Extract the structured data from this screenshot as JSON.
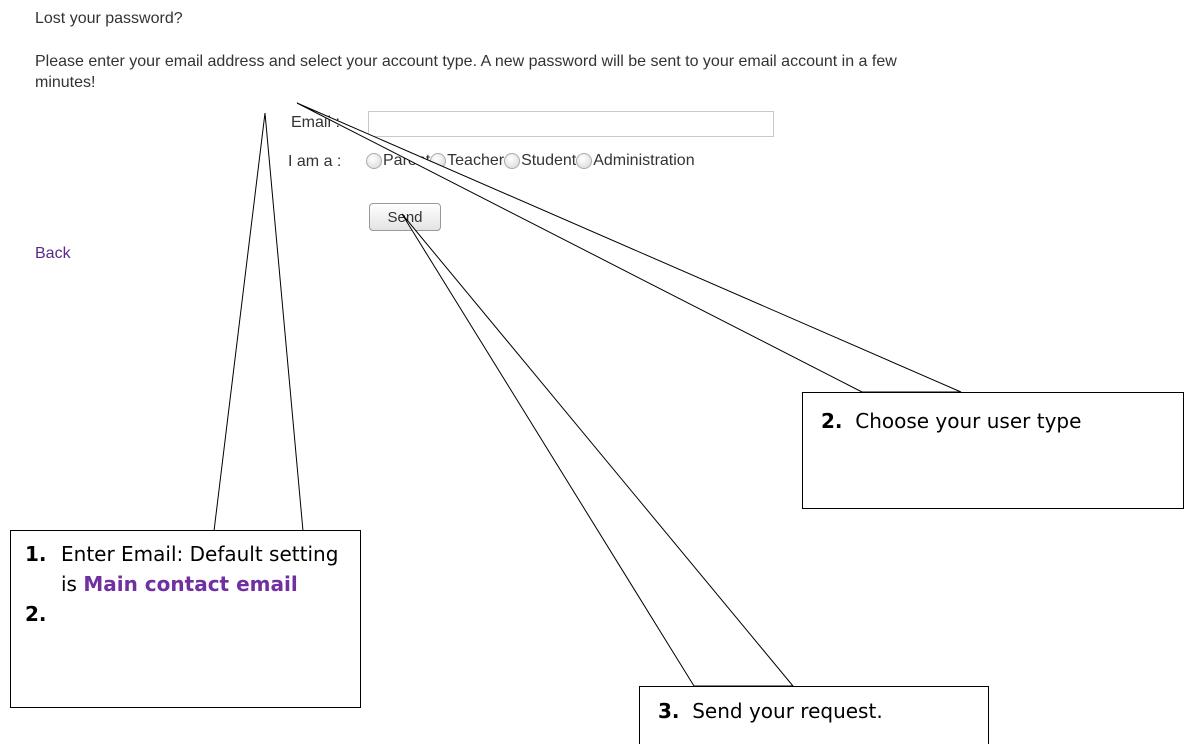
{
  "page": {
    "heading": "Lost your password?",
    "intro": "Please enter your email address and select your account type. A new password will be sent to your email account in a few minutes!"
  },
  "form": {
    "email_label": "Email :",
    "email_value": "",
    "account_type_label": "I am a :",
    "account_types": [
      "Parent",
      "Teacher",
      "Student",
      "Administration"
    ],
    "send_label": "Send"
  },
  "back_label": "Back",
  "callouts": {
    "c1": {
      "num": "1.",
      "text": "Enter Email: Default setting is",
      "highlight": "Main contact email",
      "num2": "2."
    },
    "c2": {
      "num": "2.",
      "text": "Choose your user type"
    },
    "c3": {
      "num": "3.",
      "text": "Send your request."
    }
  },
  "colors": {
    "link": "#5b2a86",
    "highlight": "#7030a0"
  }
}
